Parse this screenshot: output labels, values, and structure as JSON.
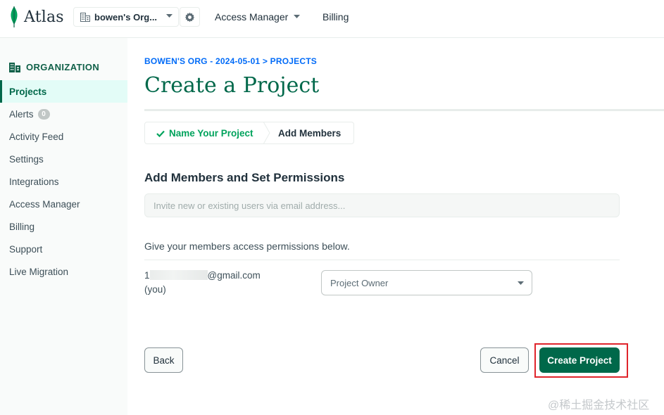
{
  "topbar": {
    "logo_text": "Atlas",
    "org_selector": "bowen's Org...",
    "access_manager": "Access Manager",
    "billing": "Billing"
  },
  "sidebar": {
    "header": "ORGANIZATION",
    "items": [
      {
        "label": "Projects",
        "active": true
      },
      {
        "label": "Alerts",
        "badge": "0"
      },
      {
        "label": "Activity Feed"
      },
      {
        "label": "Settings"
      },
      {
        "label": "Integrations"
      },
      {
        "label": "Access Manager"
      },
      {
        "label": "Billing"
      },
      {
        "label": "Support"
      },
      {
        "label": "Live Migration"
      }
    ]
  },
  "main": {
    "breadcrumb": "BOWEN'S ORG - 2024-05-01 > PROJECTS",
    "title": "Create a Project",
    "steps": [
      {
        "label": "Name Your Project",
        "completed": true
      },
      {
        "label": "Add Members",
        "completed": false
      }
    ],
    "section_title": "Add Members and Set Permissions",
    "invite_placeholder": "Invite new or existing users via email address...",
    "permissions_text": "Give your members access permissions below.",
    "member": {
      "email_prefix": "1",
      "email_suffix": "@gmail.com",
      "you_label": "(you)",
      "role": "Project Owner"
    },
    "buttons": {
      "back": "Back",
      "cancel": "Cancel",
      "create": "Create Project"
    }
  },
  "watermark": "@稀土掘金技术社区",
  "colors": {
    "brand_green": "#00684a",
    "step_green": "#00a35c",
    "link_blue": "#016bf8",
    "highlight_red": "#e0242b"
  }
}
